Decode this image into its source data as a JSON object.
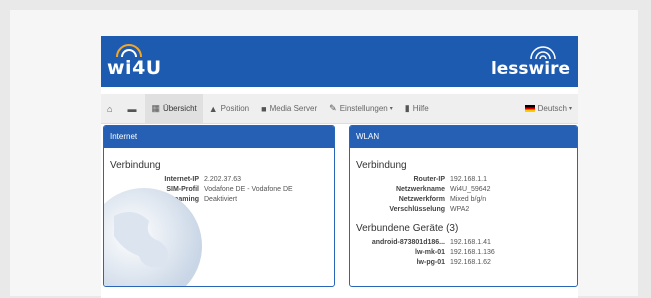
{
  "brand": {
    "left_logo": "wi4U",
    "right_logo": "lesswire"
  },
  "nav": {
    "home_icon": "home-icon",
    "chat_icon": "chat-icon",
    "items": [
      {
        "label": "Übersicht",
        "icon": "grid-icon",
        "active": true
      },
      {
        "label": "Position",
        "icon": "location-icon"
      },
      {
        "label": "Media Server",
        "icon": "media-icon"
      },
      {
        "label": "Einstellungen",
        "icon": "wrench-icon",
        "dropdown": true
      },
      {
        "label": "Hilfe",
        "icon": "book-icon"
      }
    ],
    "language": "Deutsch"
  },
  "internet": {
    "title": "Internet",
    "section": "Verbindung",
    "rows": [
      {
        "key": "Internet-IP",
        "value": "2.202.37.63"
      },
      {
        "key": "SIM-Profil",
        "value": "Vodafone DE - Vodafone DE"
      },
      {
        "key": "Roaming",
        "value": "Deaktiviert"
      }
    ]
  },
  "wlan": {
    "title": "WLAN",
    "section": "Verbindung",
    "rows": [
      {
        "key": "Router-IP",
        "value": "192.168.1.1"
      },
      {
        "key": "Netzwerkname",
        "value": "Wi4U_59642"
      },
      {
        "key": "Netzwerkform",
        "value": "Mixed b/g/n"
      },
      {
        "key": "Verschlüsselung",
        "value": "WPA2"
      }
    ],
    "devices_title": "Verbundene Geräte (3)",
    "devices": [
      {
        "key": "android-873801d186...",
        "value": "192.168.1.41"
      },
      {
        "key": "lw-mk-01",
        "value": "192.168.1.136"
      },
      {
        "key": "lw-pg-01",
        "value": "192.168.1.62"
      }
    ]
  },
  "colors": {
    "brand_blue": "#1d5bb0",
    "panel_head": "#2560b4"
  }
}
